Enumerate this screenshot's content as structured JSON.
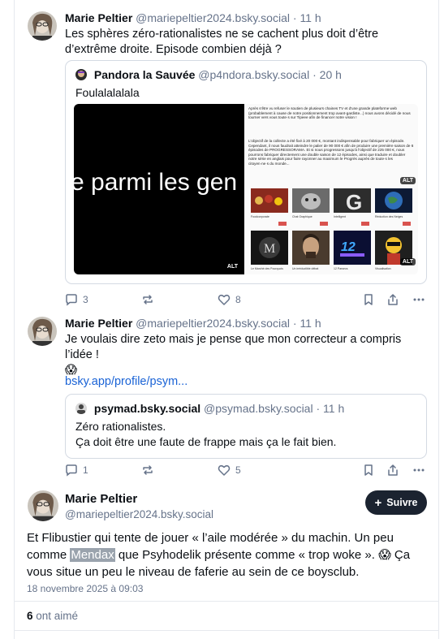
{
  "post1": {
    "author_name": "Marie Peltier",
    "author_handle": "@mariepeltier2024.bsky.social",
    "time": "11 h",
    "text": "Les sphères zéro-rationalistes ne se cachent plus doit d’être d’extrême droite. Episode combien déjà ?",
    "quote": {
      "author_name": "Pandora la Sauvée",
      "author_handle": "@p4ndora.bsky.social",
      "time": "20 h",
      "text": "Foulalalalala",
      "image_left_caption": "e parmi les gen",
      "image_right_text_1": "Après s'être vu refuser le soutien de plusieurs chaines TV et d'une grande plateforme web (probablement à cause de notre positionnement trop avant-gardiste...) nous avons décidé de nous tourner vers vous toute·s sur Tipeee afin de financer notre vision !",
      "image_right_text_2": "L'objectif de la collecte a été fixé à 20 000 €, montant indispensable pour fabriquer un épisode. Cependant, il nous faudrait atteindre le palier de 90 000 € afin de produire une première saison de 6 épisodes de PROGRESSORAMA. Et si nous progressons jusqu'à l'objectif de 225 000 €, nous pourrons fabriquer directement une double saison de 12 épisodes, ainsi que traduire et doubler notre série en anglais pour faire rayonner au maximum le Progrès auprès de toute·s les citoyen·ne·s du monde...",
      "alt_label": "ALT",
      "thumbs": [
        "Foodcorporate",
        "Chat Graphique",
        "Intelligent",
        "Réduction des Neiges",
        "Le Marché des Pourquois",
        "Un irréductible débat",
        "12 Parsecs",
        "Visualisation"
      ]
    },
    "replies": "3",
    "likes": "8"
  },
  "post2": {
    "author_name": "Marie Peltier",
    "author_handle": "@mariepeltier2024.bsky.social",
    "time": "11 h",
    "text": "Je voulais dire zeto mais je pense que mon correcteur a compris l’idée !",
    "emoji": "😱",
    "link": "bsky.app/profile/psym...",
    "quote": {
      "author_name": "psymad.bsky.social",
      "author_handle": "@psymad.bsky.social",
      "time": "11 h",
      "line1": "Zéro rationalistes.",
      "line2": "Ça doit être une faute de frappe mais ça le fait bien."
    },
    "replies": "1",
    "likes": "5"
  },
  "main": {
    "author_name": "Marie Peltier",
    "author_handle": "@mariepeltier2024.bsky.social",
    "follow_label": "Suivre",
    "text_before": "Et Flibustier qui tente de jouer « l’aile modérée » du machin. Un peu comme ",
    "highlight": "Mendax",
    "text_after": " que Psyhodelik présente comme « trop woke ».",
    "emoji": "😱",
    "text_end": " Ça vous situe un peu le niveau de faferie au sein de ce boysclub.",
    "date": "18 novembre 2025 à 09:03",
    "likes_count": "6",
    "likes_label": "ont aimé"
  },
  "colors": {
    "accent": "#1a63d6",
    "muted": "#66738a",
    "border": "#d4dae3",
    "follow_bg": "#1b2330"
  }
}
